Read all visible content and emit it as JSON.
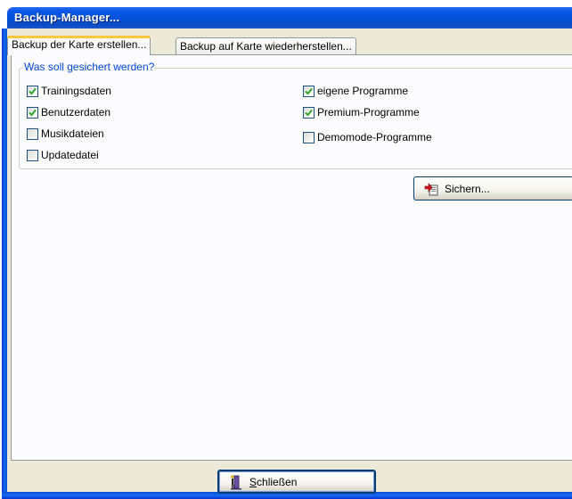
{
  "window": {
    "title": "Backup-Manager..."
  },
  "tabs": [
    {
      "label": "Backup der Karte erstellen...",
      "active": true
    },
    {
      "label": "Backup auf Karte wiederherstellen...",
      "active": false
    }
  ],
  "group": {
    "title": "Was soll gesichert werden?",
    "left_options": [
      {
        "label": "Trainingsdaten",
        "checked": true
      },
      {
        "label": "Benutzerdaten",
        "checked": true
      },
      {
        "label": "Musikdateien",
        "checked": false
      },
      {
        "label": "Updatedatei",
        "checked": false
      }
    ],
    "right_options": [
      {
        "label": "eigene Programme",
        "checked": true
      },
      {
        "label": "Premium-Programme",
        "checked": true
      },
      {
        "label": "Demomode-Programme",
        "checked": false
      }
    ]
  },
  "buttons": {
    "save_label": "Sichern...",
    "close_label": "Schließen",
    "close_mnemonic": "S",
    "close_rest": "chließen"
  },
  "icons": {
    "save": "backup-save-icon",
    "close": "exit-door-icon"
  },
  "colors": {
    "titlebar": "#0551d8",
    "group_title": "#0046d5",
    "checkmark": "#21a121",
    "active_tab_highlight": "#ffc83c"
  }
}
